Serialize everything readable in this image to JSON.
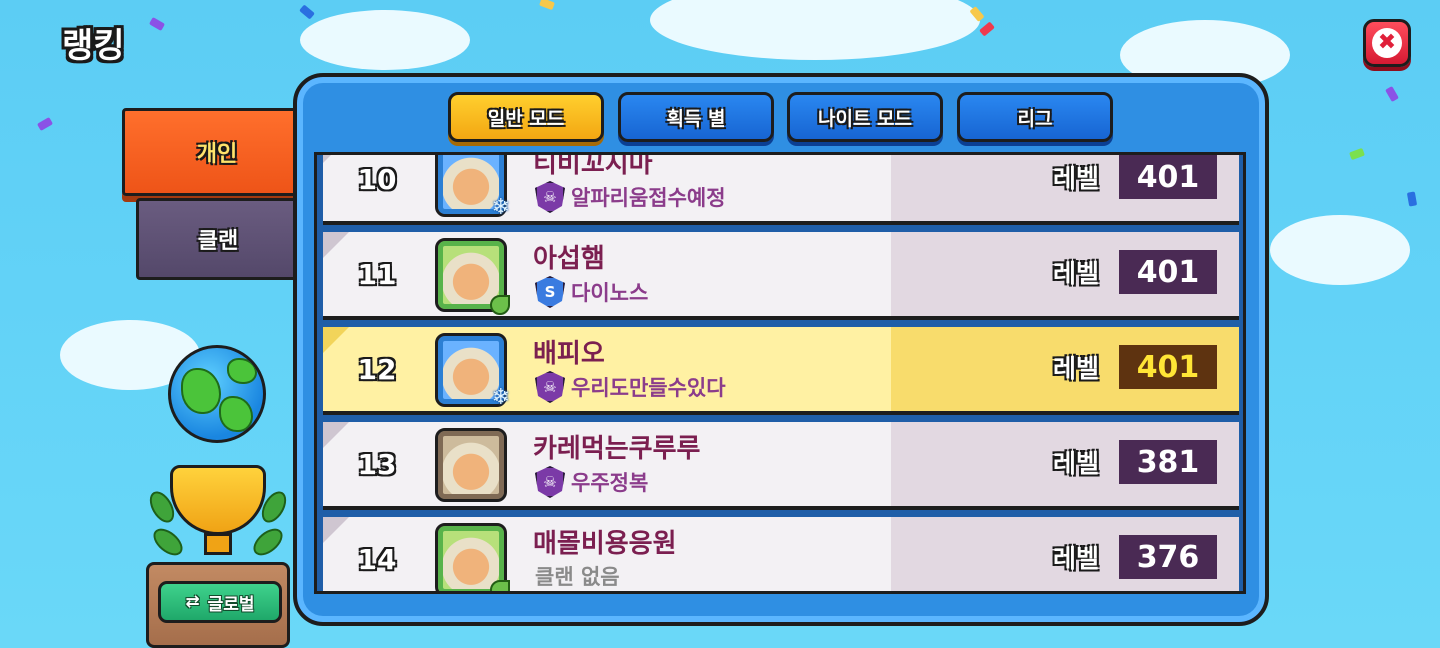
{
  "page": {
    "title": "랭킹"
  },
  "colors": {
    "accent": "#f3a712",
    "panel": "#2f8fe3",
    "highlight_row": "#fff1a3",
    "level_box": "#4a2a54"
  },
  "close_button": {
    "icon": "close-icon",
    "glyph": "✖"
  },
  "side_tabs": [
    {
      "label": "개인",
      "active": true
    },
    {
      "label": "클랜",
      "active": false
    }
  ],
  "global_button": {
    "label": "글로벌",
    "icon": "refresh-icon",
    "glyph": "⇄"
  },
  "mode_tabs": [
    {
      "label": "일반 모드",
      "active": true
    },
    {
      "label": "획득 별",
      "active": false
    },
    {
      "label": "나이트 모드",
      "active": false
    },
    {
      "label": "리그",
      "active": false
    }
  ],
  "level_label": "레벨",
  "rows": [
    {
      "rank": "10",
      "name": "티비꼬지마",
      "clan": "알파리움접수예정",
      "clan_emblem": "skull-emblem",
      "clan_glyph": "☠",
      "level": "401"
    },
    {
      "rank": "11",
      "name": "아섭햄",
      "clan": "다이노스",
      "clan_emblem": "s-emblem",
      "clan_glyph": "S",
      "level": "401"
    },
    {
      "rank": "12",
      "name": "배피오",
      "clan": "우리도만들수있다",
      "clan_emblem": "skull-emblem",
      "clan_glyph": "☠",
      "level": "401"
    },
    {
      "rank": "13",
      "name": "카레먹는쿠루루",
      "clan": "우주정복",
      "clan_emblem": "skull-emblem",
      "clan_glyph": "☠",
      "level": "381"
    },
    {
      "rank": "14",
      "name": "매몰비용응원",
      "clan": "클랜 없음",
      "clan_emblem": "",
      "clan_glyph": "",
      "level": "376"
    }
  ]
}
